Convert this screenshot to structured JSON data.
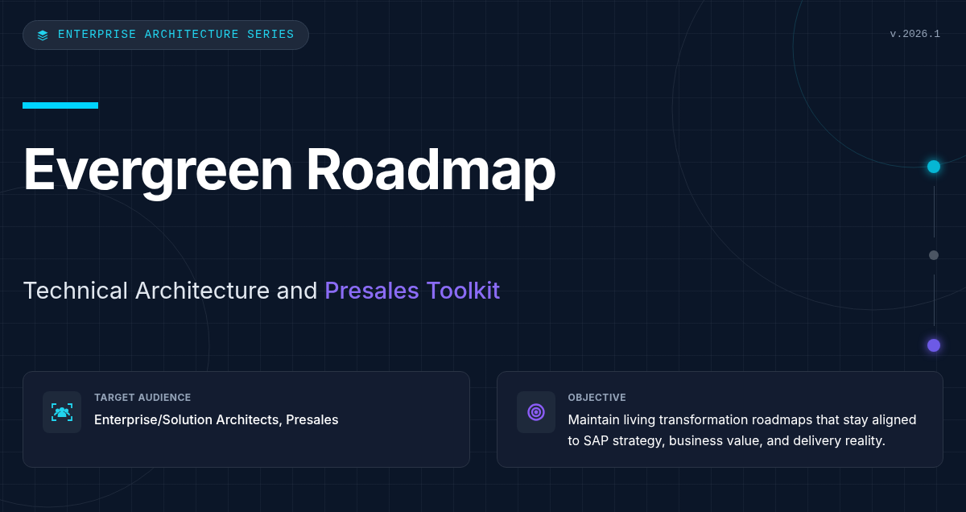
{
  "badge": {
    "label": "ENTERPRISE ARCHITECTURE SERIES"
  },
  "version": "v.2026.1",
  "title": "Evergreen Roadmap",
  "subtitle": {
    "text": "Technical Architecture and",
    "highlight": "Presales Toolkit"
  },
  "timeline": [
    {
      "color": "#06b6d4"
    },
    {
      "color": "#4b5563"
    },
    {
      "color": "#6d5ae6"
    }
  ],
  "cards": [
    {
      "kind": "audience",
      "label": "TARGET AUDIENCE",
      "text": "Enterprise/Solution Architects, Presales"
    },
    {
      "kind": "objective",
      "label": "OBJECTIVE",
      "text": "Maintain living transformation roadmaps that stay aligned to SAP strategy, business value, and delivery reality."
    }
  ]
}
